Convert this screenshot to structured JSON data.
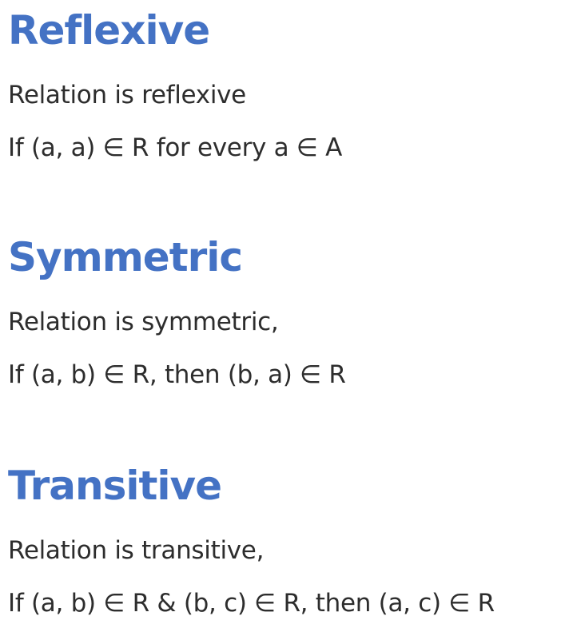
{
  "sections": [
    {
      "title": "Reflexive",
      "line1": "Relation is reflexive",
      "line2": "If (a, a) ∈ R for every a ∈ A"
    },
    {
      "title": "Symmetric",
      "line1": "Relation is symmetric,",
      "line2": "If (a, b) ∈ R, then (b, a) ∈ R"
    },
    {
      "title": "Transitive",
      "line1": "Relation is transitive,",
      "line2": "If (a, b) ∈ R & (b, c) ∈ R, then (a, c) ∈ R"
    }
  ],
  "colors": {
    "heading": "#4472c4",
    "text": "#2d2d2d",
    "background": "#ffffff"
  }
}
